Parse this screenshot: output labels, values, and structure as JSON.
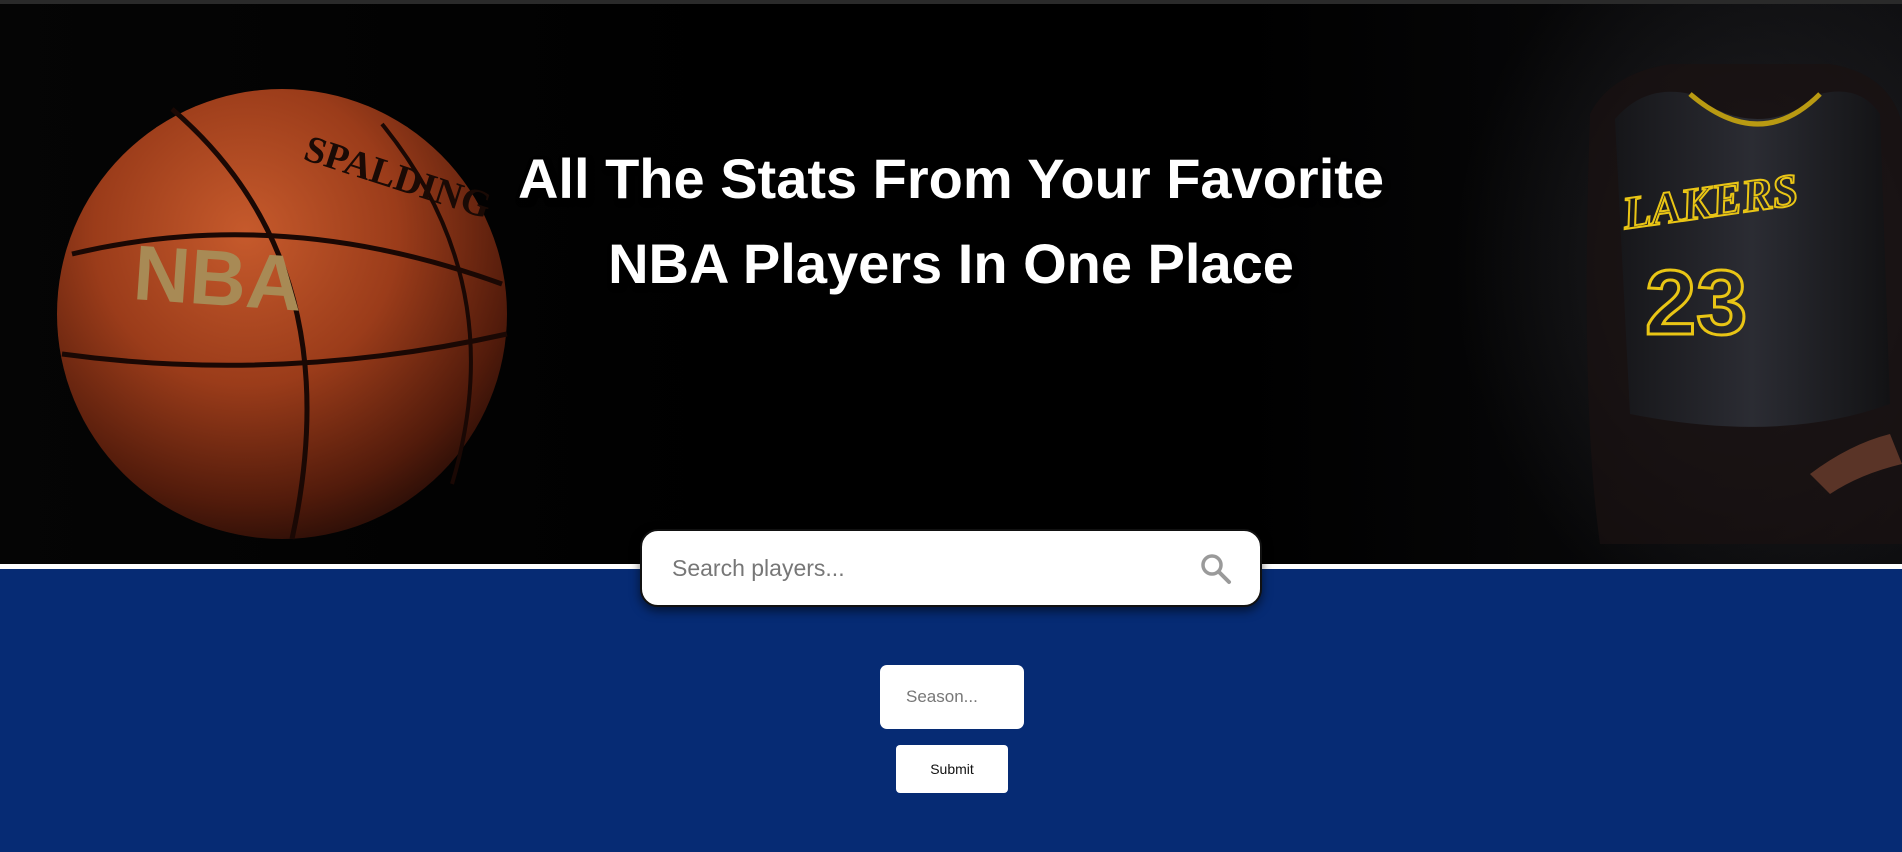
{
  "hero": {
    "headline_line1": "All The Stats From Your Favorite",
    "headline_line2": "NBA Players In One Place",
    "background_images": [
      "basketball-photo",
      "jersey-photo"
    ],
    "ball_brand": "SPALDING",
    "ball_logo": "NBA",
    "jersey_team": "LAKERS",
    "jersey_number": "23"
  },
  "search": {
    "placeholder": "Search players...",
    "icon": "search-icon"
  },
  "season": {
    "placeholder": "Season..."
  },
  "submit": {
    "label": "Submit"
  },
  "colors": {
    "hero_background": "#000000",
    "lower_background": "#062b74",
    "divider": "#ffffff",
    "headline_text": "#ffffff",
    "ball_orange": "#a7431f",
    "jersey_gold": "#e9c515"
  }
}
